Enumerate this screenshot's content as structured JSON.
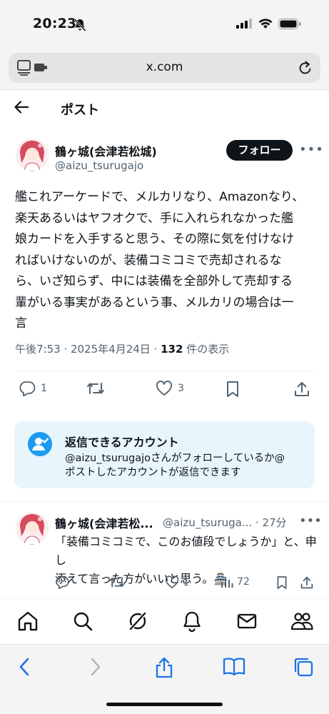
{
  "status": {
    "time": "20:23"
  },
  "browser": {
    "url": "x.com"
  },
  "header": {
    "title": "ポスト"
  },
  "post": {
    "author_name": "鶴ヶ城(会津若松城)",
    "author_handle": "@aizu_tsurugajo",
    "follow_label": "フォロー",
    "body": "艦これアーケードで、メルカリなり、Amazonなり、\n楽天あるいはヤフオクで、手に入れられなかった艦\n娘カードを入手すると思う、その際に気を付けなけ\nればいけないのが、装備コミコミで売却されるな\nら、いざ知らず、中には装備を全部外して売却する\n輩がいる事実があるという事、メルカリの場合は一\n言",
    "timestamp": "午後7:53 · 2025年4月24日 · ",
    "views_count": "132",
    "views_label": " 件の表示",
    "replies": "1",
    "reposts": "",
    "likes": "3"
  },
  "reply_restriction": {
    "title": "返信できるアカウント",
    "description": "@aizu_tsurugajoさんがフォローしているか@\nポストしたアカウントが返信できます"
  },
  "reply": {
    "author_name": "鶴ヶ城(会津若松...",
    "author_handle": "@aizu_tsuruga... · 27分",
    "body": "「装備コミコミで、このお値段でしょうか」と、申し\n添えて言った方がいいと思う。🏯",
    "likes": "1",
    "views": "72"
  },
  "colors": {
    "accent": "#1d9bf0",
    "text": "#0f1419",
    "muted": "#536471",
    "reply_box_bg": "#e8f5fd"
  }
}
